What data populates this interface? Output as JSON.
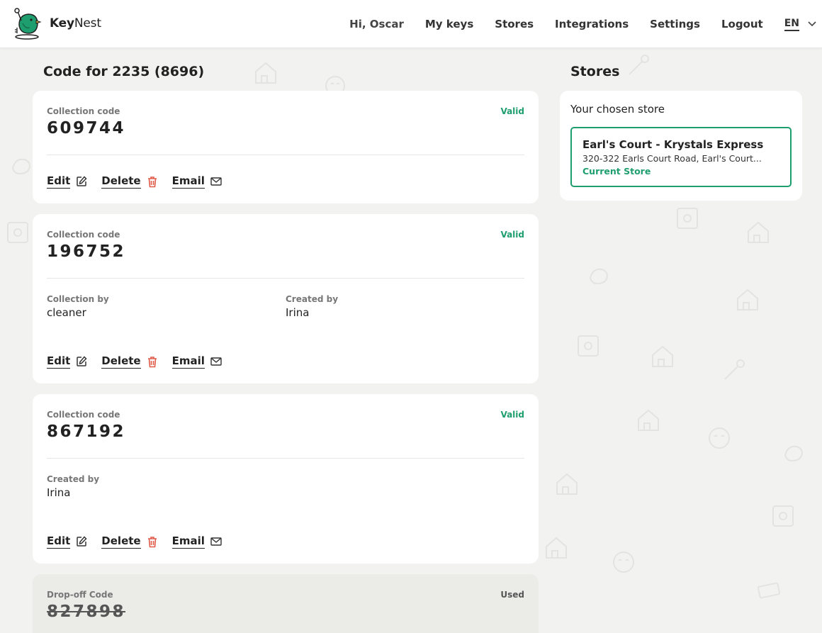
{
  "header": {
    "brand": {
      "key": "Key",
      "nest": "Nest"
    },
    "greeting": "Hi, Oscar",
    "nav": [
      {
        "label": "My keys",
        "name": "nav-my-keys"
      },
      {
        "label": "Stores",
        "name": "nav-stores"
      },
      {
        "label": "Integrations",
        "name": "nav-integrations"
      },
      {
        "label": "Settings",
        "name": "nav-settings"
      },
      {
        "label": "Logout",
        "name": "nav-logout"
      }
    ],
    "language": "EN"
  },
  "page": {
    "title": "Code for 2235 (8696)"
  },
  "actions": {
    "edit": "Edit",
    "delete": "Delete",
    "email": "Email"
  },
  "cards": [
    {
      "label": "Collection code",
      "code": "609744",
      "status": "Valid"
    },
    {
      "label": "Collection code",
      "code": "196752",
      "status": "Valid",
      "collection_by_label": "Collection by",
      "collection_by": "cleaner",
      "created_by_label": "Created by",
      "created_by": "Irina"
    },
    {
      "label": "Collection code",
      "code": "867192",
      "status": "Valid",
      "created_by_label": "Created by",
      "created_by": "Irina"
    },
    {
      "label": "Drop-off Code",
      "code": "827898",
      "status": "Used"
    }
  ],
  "stores": {
    "title": "Stores",
    "chosen_label": "Your chosen store",
    "store_name": "Earl's Court - Krystals Express",
    "store_address": "320-322 Earls Court Road, Earl's Court...",
    "current_label": "Current Store"
  },
  "colors": {
    "accent_green": "#1e9e6e",
    "delete_red": "#e05a4a",
    "background": "#f2f2f0"
  }
}
